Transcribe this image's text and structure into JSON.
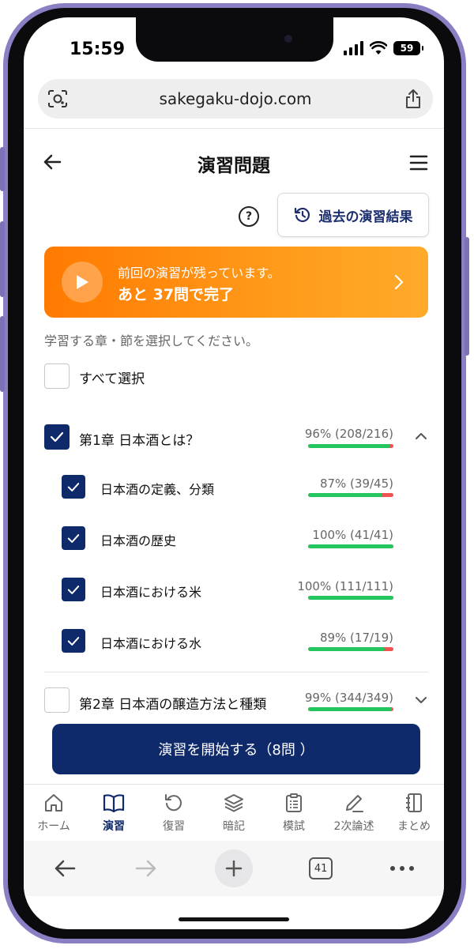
{
  "status": {
    "time": "15:59",
    "battery": "59"
  },
  "browser": {
    "url": "sakegaku-dojo.com",
    "tab_count": "41"
  },
  "header": {
    "title": "演習問題"
  },
  "history_button": {
    "label": "過去の演習結果"
  },
  "help": {
    "symbol": "?"
  },
  "banner": {
    "line1": "前回の演習が残っています。",
    "line2": "あと 37問で完了"
  },
  "instruction": "学習する章・節を選択してください。",
  "select_all": {
    "label": "すべて選択",
    "checked": false
  },
  "chapters": [
    {
      "label": "第1章 日本酒とは？",
      "progress_text": "96% (208/216)",
      "correct": 208,
      "total": 216,
      "checked": true,
      "expanded": true,
      "sections": [
        {
          "label": "日本酒の定義、分類",
          "progress_text": "87% (39/45)",
          "correct": 39,
          "total": 45,
          "checked": true
        },
        {
          "label": "日本酒の歴史",
          "progress_text": "100% (41/41)",
          "correct": 41,
          "total": 41,
          "checked": true
        },
        {
          "label": "日本酒における米",
          "progress_text": "100% (111/111)",
          "correct": 111,
          "total": 111,
          "checked": true
        },
        {
          "label": "日本酒における水",
          "progress_text": "89% (17/19)",
          "correct": 17,
          "total": 19,
          "checked": true
        }
      ]
    },
    {
      "label": "第2章 日本酒の醸造方法と種類",
      "progress_text": "99% (344/349)",
      "correct": 344,
      "total": 349,
      "checked": false,
      "expanded": false
    }
  ],
  "start_button": {
    "label": "演習を開始する（8問 ）"
  },
  "tabs": [
    {
      "label": "ホーム",
      "icon": "home-icon",
      "active": false
    },
    {
      "label": "演習",
      "icon": "book-icon",
      "active": true
    },
    {
      "label": "復習",
      "icon": "refresh-icon",
      "active": false
    },
    {
      "label": "暗記",
      "icon": "layers-icon",
      "active": false
    },
    {
      "label": "模試",
      "icon": "clipboard-icon",
      "active": false
    },
    {
      "label": "2次論述",
      "icon": "pen-icon",
      "active": false
    },
    {
      "label": "まとめ",
      "icon": "notebook-icon",
      "active": false
    }
  ],
  "colors": {
    "primary": "#0f2a6b",
    "accent_orange": "#ff8a00",
    "progress_green": "#22c55e",
    "progress_red": "#ef5350"
  }
}
